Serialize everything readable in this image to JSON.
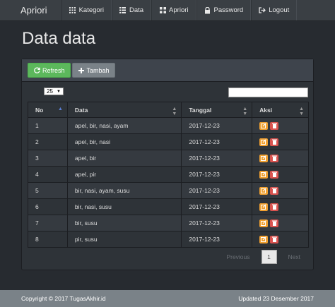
{
  "navbar": {
    "brand": "Apriori",
    "items": [
      {
        "label": "Kategori",
        "icon": "grid-icon"
      },
      {
        "label": "Data",
        "icon": "list-icon"
      },
      {
        "label": "Apriori",
        "icon": "grid-icon"
      },
      {
        "label": "Password",
        "icon": "lock-icon"
      },
      {
        "label": "Logout",
        "icon": "logout-icon"
      }
    ]
  },
  "page": {
    "title": "Data data"
  },
  "toolbar": {
    "refresh_label": "Refresh",
    "add_label": "Tambah"
  },
  "controls": {
    "page_size": "25",
    "search_value": ""
  },
  "table": {
    "headers": [
      "No",
      "Data",
      "Tanggal",
      "Aksi"
    ],
    "rows": [
      {
        "no": "1",
        "data": "apel, bir, nasi, ayam",
        "tanggal": "2017-12-23"
      },
      {
        "no": "2",
        "data": "apel, bir, nasi",
        "tanggal": "2017-12-23"
      },
      {
        "no": "3",
        "data": "apel, bir",
        "tanggal": "2017-12-23"
      },
      {
        "no": "4",
        "data": "apel, pir",
        "tanggal": "2017-12-23"
      },
      {
        "no": "5",
        "data": "bir, nasi, ayam, susu",
        "tanggal": "2017-12-23"
      },
      {
        "no": "6",
        "data": "bir, nasi, susu",
        "tanggal": "2017-12-23"
      },
      {
        "no": "7",
        "data": "bir, susu",
        "tanggal": "2017-12-23"
      },
      {
        "no": "8",
        "data": "pir, susu",
        "tanggal": "2017-12-23"
      }
    ]
  },
  "pagination": {
    "previous": "Previous",
    "current": "1",
    "next": "Next"
  },
  "footer": {
    "copyright": "Copyright © 2017 TugasAkhir.id",
    "updated": "Updated 23 Desember 2017"
  },
  "colors": {
    "background": "#272b30",
    "navbar": "#3a3f44",
    "refresh": "#5cb85c",
    "add": "#7a8288",
    "edit": "#f0a030",
    "delete": "#d9534f",
    "footer": "#7a8288"
  }
}
